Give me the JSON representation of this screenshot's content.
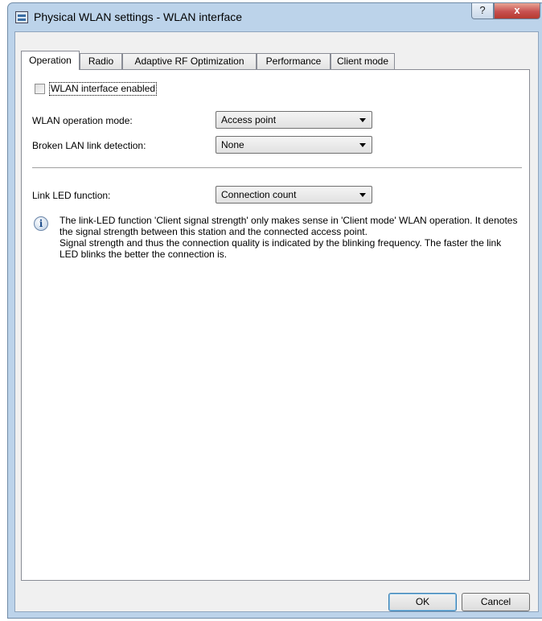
{
  "window": {
    "title": "Physical WLAN settings - WLAN interface",
    "help_label": "?",
    "close_label": "x"
  },
  "tabs": [
    {
      "label": "Operation",
      "active": true
    },
    {
      "label": "Radio",
      "active": false
    },
    {
      "label": "Adaptive RF Optimization",
      "active": false
    },
    {
      "label": "Performance",
      "active": false
    },
    {
      "label": "Client mode",
      "active": false
    }
  ],
  "form": {
    "wlan_enabled_label": "WLAN interface enabled",
    "wlan_enabled_checked": false,
    "operation_mode_label": "WLAN operation mode:",
    "operation_mode_value": "Access point",
    "broken_lan_label": "Broken LAN link detection:",
    "broken_lan_value": "None",
    "link_led_label": "Link LED function:",
    "link_led_value": "Connection count"
  },
  "info": {
    "icon": "info-icon",
    "line1": "The link-LED function 'Client signal strength' only makes sense in 'Client mode' WLAN operation. It denotes the signal strength between this station and the connected access point.",
    "line2": "Signal strength and thus the connection quality is indicated by the blinking frequency. The faster the link LED blinks the better the connection is."
  },
  "buttons": {
    "ok_label": "OK",
    "cancel_label": "Cancel"
  }
}
